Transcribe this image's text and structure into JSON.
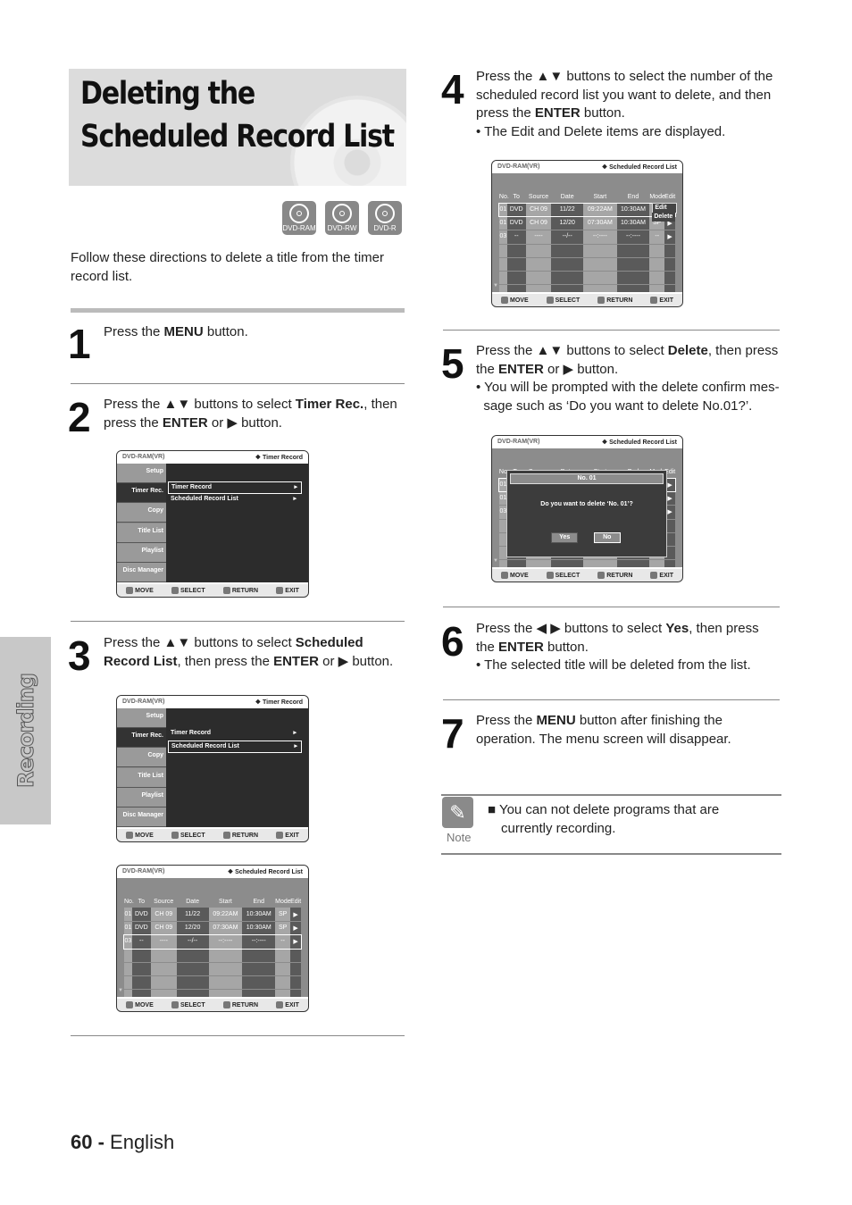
{
  "title": [
    "Deleting the",
    "Scheduled Record List"
  ],
  "discs": [
    "DVD-RAM",
    "DVD-RW",
    "DVD-R"
  ],
  "intro": "Follow these directions to delete a title from the timer record list.",
  "section_tab": "Recording",
  "steps": [
    {
      "n": "1",
      "html": "Press the <b>MENU</b> button."
    },
    {
      "n": "2",
      "html": "Press the ▲▼ buttons to select <b>Timer Rec.</b>, then press the <b>ENTER</b> or ▶ button."
    },
    {
      "n": "3",
      "html": "Press the ▲▼ buttons to select <b>Scheduled Record List</b>, then press the <b>ENTER</b> or ▶ button."
    },
    {
      "n": "4",
      "html": "Press the ▲▼ buttons to select the number of the scheduled record list you want to delete, and then press the <b>ENTER</b> button.<br>• The Edit and Delete items are displayed."
    },
    {
      "n": "5",
      "html": "Press the ▲▼ buttons to select <b>Delete</b>, then press the <b>ENTER</b> or ▶ button.<br>• You will be prompted with the delete confirm mes-<br>&nbsp;&nbsp;sage such as ‘Do you want to delete No.01?’."
    },
    {
      "n": "6",
      "html": "Press the ◀ ▶ buttons to select <b>Yes</b>, then press the <b>ENTER</b> button.<br>• The selected title will be deleted from the list."
    },
    {
      "n": "7",
      "html": "Press the <b>MENU</b> button after finishing the operation. The menu screen will disappear."
    }
  ],
  "note": {
    "label": "Note",
    "text": "■ You can not delete programs that are",
    "text2": "currently recording."
  },
  "footer": {
    "page": "60 -",
    "lang": " English"
  },
  "screen_common": {
    "source": "DVD-RAM(VR)",
    "footer": [
      "MOVE",
      "SELECT",
      "RETURN",
      "EXIT"
    ],
    "menu_side": [
      "Setup",
      "Timer Rec.",
      "Copy",
      "Title List",
      "Playlist",
      "Disc Manager"
    ],
    "columns": [
      "No.",
      "To",
      "Source",
      "Date",
      "Start",
      "End",
      "Mode",
      "Edit"
    ]
  },
  "screens": [
    {
      "type": "menu",
      "title": "❖ Timer Record",
      "items": [
        "Timer Record",
        "Scheduled Record List"
      ],
      "selected": 0
    },
    {
      "type": "menu",
      "title": "❖ Timer Record",
      "items": [
        "Timer Record",
        "Scheduled Record List"
      ],
      "selected": 1
    },
    {
      "type": "list",
      "title": "❖ Scheduled Record List",
      "rows": [
        [
          "01",
          "DVD",
          "CH 09",
          "11/22",
          "09:22AM",
          "10:30AM",
          "SP",
          "▶"
        ],
        [
          "01",
          "DVD",
          "CH 09",
          "12/20",
          "07:30AM",
          "10:30AM",
          "SP",
          "▶"
        ],
        [
          "03",
          "--",
          "----",
          "--/--",
          "--:----",
          "--:----",
          "--",
          "▶"
        ]
      ],
      "selected": 2
    },
    {
      "type": "list",
      "title": "❖ Scheduled Record List",
      "rows": [
        [
          "01",
          "DVD",
          "CH 09",
          "11/22",
          "09:22AM",
          "10:30AM",
          "",
          ""
        ],
        [
          "01",
          "DVD",
          "CH 09",
          "12/20",
          "07:30AM",
          "10:30AM",
          "SP",
          "▶"
        ],
        [
          "03",
          "--",
          "----",
          "--/--",
          "--:----",
          "--:----",
          "--",
          "▶"
        ]
      ],
      "selected": 0,
      "popup": [
        "Edit",
        "Delete"
      ]
    },
    {
      "type": "list",
      "title": "❖ Scheduled Record List",
      "rows": [
        [
          "01",
          "",
          "",
          "",
          "",
          "",
          "",
          "▶"
        ],
        [
          "01",
          "",
          "",
          "",
          "",
          "",
          "",
          "▶"
        ],
        [
          "03",
          "",
          "",
          "",
          "",
          "",
          "",
          "▶"
        ]
      ],
      "selected": 0,
      "dialog": {
        "title": "No. 01",
        "message": "Do you want to delete ‘No. 01’?",
        "buttons": [
          "Yes",
          "No"
        ],
        "selected": 1
      }
    }
  ]
}
